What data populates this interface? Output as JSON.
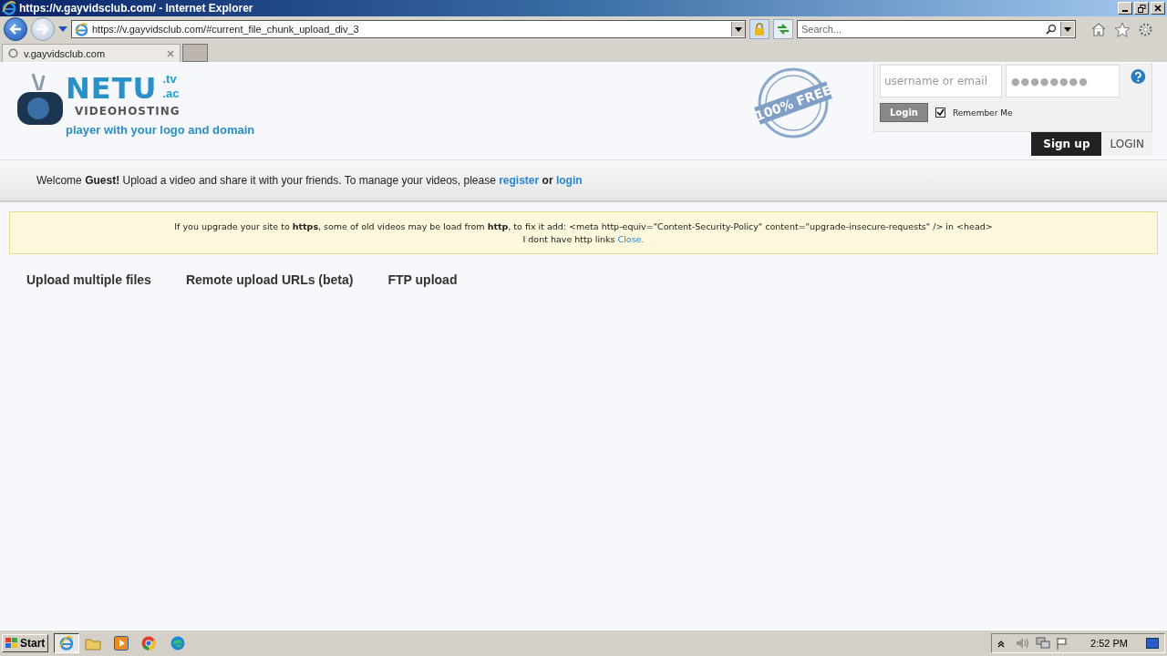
{
  "window": {
    "title": "https://v.gayvidsclub.com/ - Internet Explorer"
  },
  "browser": {
    "address": "https://v.gayvidsclub.com/#current_file_chunk_upload_div_3",
    "search_placeholder": "Search...",
    "tabs": [
      {
        "label": "v.gayvidsclub.com",
        "selected": true
      }
    ]
  },
  "header": {
    "logo": {
      "name": "NETU",
      "domains": [
        ".tv",
        ".ac"
      ],
      "subtitle": "VIDEOHOSTING",
      "tagline": "player with your logo and domain"
    },
    "stamp": "100% FREE",
    "login_form": {
      "username_placeholder": "username or email",
      "password_dots": "●●●●●●●●",
      "login_button": "Login",
      "remember_me": {
        "label": "Remember Me",
        "checked": true
      }
    },
    "auth_tabs": [
      {
        "label": "Sign up",
        "selected": true
      },
      {
        "label": "LOGIN",
        "selected": false
      }
    ]
  },
  "welcome": {
    "text": "Welcome **Guest!** Upload a video and share it with your friends. To manage your videos, please ",
    "link_1": "register",
    "joiner": " **or** ",
    "link_2": "login"
  },
  "notice": {
    "line_1": "If you upgrade your site to **https**, some of old videos may be load from **http**, to fix it add: <meta http-equiv=\"Content-Security-Policy\" content=\"upgrade-insecure-requests\" /> in <head>",
    "line_2": "I dont have http links ",
    "close_link": "Close."
  },
  "upload_tabs": [
    "Upload multiple files",
    "Remote upload URLs (beta)",
    "FTP upload"
  ],
  "taskbar": {
    "start": "Start",
    "clock": "2:52 PM"
  }
}
